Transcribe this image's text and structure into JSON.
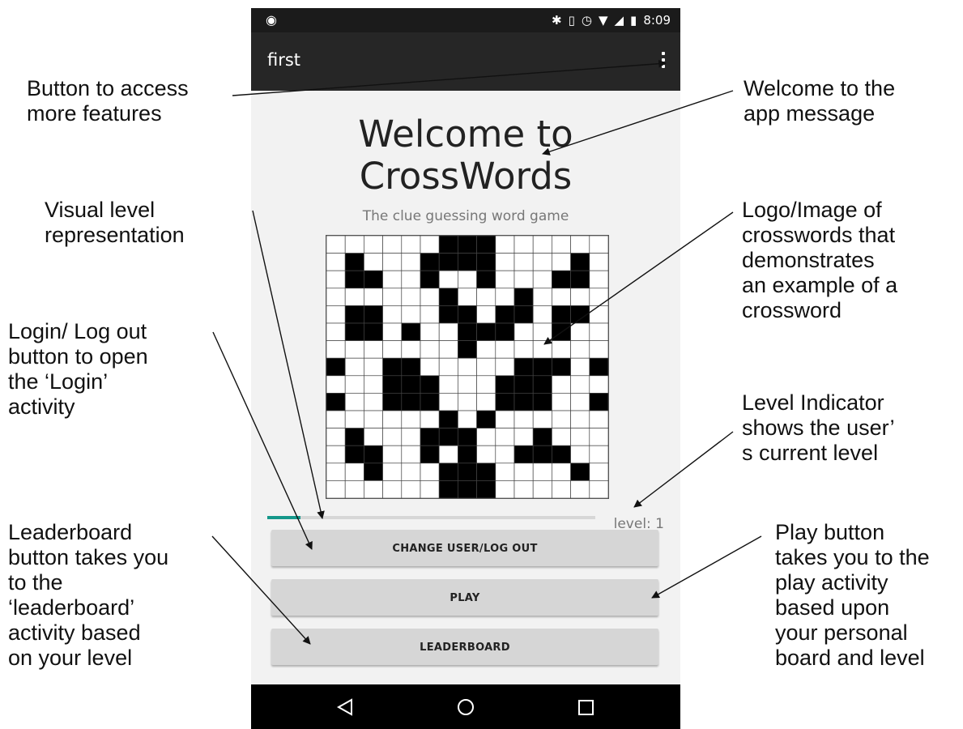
{
  "annotations": {
    "more_features": "Button to access\nmore features",
    "welcome_msg": "Welcome to the\napp message",
    "visual_level": "Visual level\nrepresentation",
    "logo_image": "Logo/Image of\ncrosswords that\ndemonstrates\nan example of a\ncrossword",
    "login_logout": "Login/ Log out\nbutton to open\nthe ‘Login’\nactivity",
    "level_indicator": "Level Indicator\nshows the user’\ns current level",
    "leaderboard": "Leaderboard\nbutton takes you\nto the\n‘leaderboard’\nactivity based\non your level",
    "play": "Play button\ntakes you to the\nplay activity\nbased upon\nyour personal\nboard and level"
  },
  "status_bar": {
    "time": "8:09"
  },
  "app_bar": {
    "title": "first"
  },
  "main": {
    "welcome": "Welcome to CrossWords",
    "subtitle": "The clue guessing word game",
    "level_label": "level: 1",
    "level_progress": 0.1
  },
  "buttons": {
    "change_user": "CHANGE USER/LOG OUT",
    "play": "PLAY",
    "leaderboard": "LEADERBOARD"
  },
  "colors": {
    "accent": "#14978a",
    "app_bar": "#262626",
    "button": "#d6d6d6"
  },
  "icons": [
    "android-icon",
    "bluetooth-icon",
    "vibrate-icon",
    "alarm-icon",
    "wifi-icon",
    "signal-icon",
    "battery-icon",
    "overflow-menu-icon",
    "back-icon",
    "home-icon",
    "recents-icon"
  ]
}
